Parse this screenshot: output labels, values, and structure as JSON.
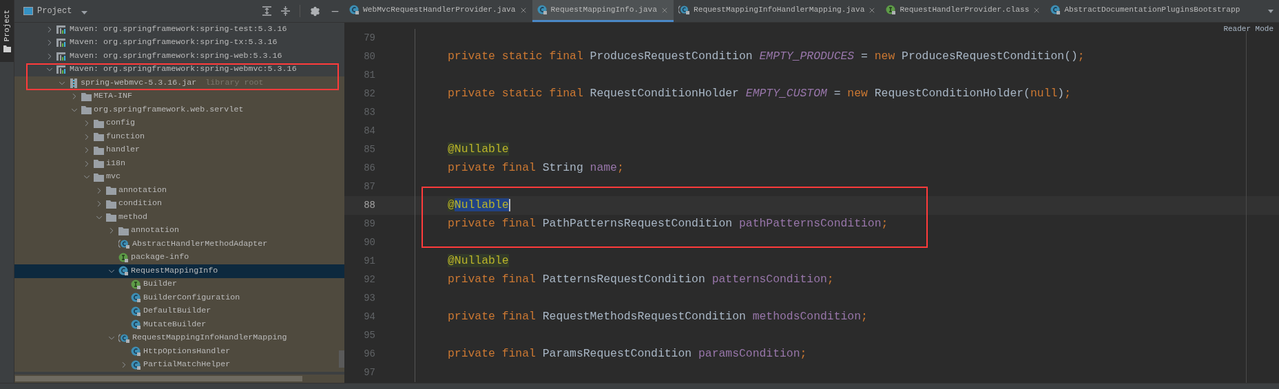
{
  "stripe": {
    "label": "Project"
  },
  "panel": {
    "title": "Project"
  },
  "tree": [
    {
      "kind": "library",
      "label": "Maven: org.springframework:spring-test:5.3.16",
      "expanded": false,
      "selected": false
    },
    {
      "kind": "library",
      "label": "Maven: org.springframework:spring-tx:5.3.16",
      "expanded": false,
      "selected": false
    },
    {
      "kind": "library",
      "label": "Maven: org.springframework:spring-web:5.3.16",
      "expanded": false,
      "selected": false
    },
    {
      "kind": "library",
      "label": "Maven: org.springframework:spring-webmvc:5.3.16",
      "expanded": true,
      "selected": false,
      "boxed": true,
      "children": [
        {
          "kind": "jar",
          "label": "spring-webmvc-5.3.16.jar",
          "note": "library root",
          "expanded": true,
          "selected": false,
          "boxed": true,
          "children": [
            {
              "kind": "folder",
              "label": "META-INF",
              "expanded": false,
              "selected": false
            },
            {
              "kind": "folder",
              "label": "org.springframework.web.servlet",
              "expanded": true,
              "selected": false,
              "children": [
                {
                  "kind": "folder",
                  "label": "config",
                  "expanded": false,
                  "selected": false
                },
                {
                  "kind": "folder",
                  "label": "function",
                  "expanded": false,
                  "selected": false
                },
                {
                  "kind": "folder",
                  "label": "handler",
                  "expanded": false,
                  "selected": false
                },
                {
                  "kind": "folder",
                  "label": "i18n",
                  "expanded": false,
                  "selected": false
                },
                {
                  "kind": "folder",
                  "label": "mvc",
                  "expanded": true,
                  "selected": false,
                  "children": [
                    {
                      "kind": "folder",
                      "label": "annotation",
                      "expanded": false,
                      "selected": false
                    },
                    {
                      "kind": "folder",
                      "label": "condition",
                      "expanded": false,
                      "selected": false
                    },
                    {
                      "kind": "folder",
                      "label": "method",
                      "expanded": true,
                      "selected": false,
                      "children": [
                        {
                          "kind": "folder",
                          "label": "annotation",
                          "expanded": false,
                          "selected": false
                        },
                        {
                          "kind": "abstract",
                          "label": "AbstractHandlerMethodAdapter",
                          "selected": false
                        },
                        {
                          "kind": "interface",
                          "label": "package-info",
                          "selected": false
                        },
                        {
                          "kind": "class",
                          "label": "RequestMappingInfo",
                          "expanded": true,
                          "selected": true,
                          "children": [
                            {
                              "kind": "interface",
                              "label": "Builder",
                              "selected": false
                            },
                            {
                              "kind": "class",
                              "label": "BuilderConfiguration",
                              "selected": false
                            },
                            {
                              "kind": "class",
                              "label": "DefaultBuilder",
                              "selected": false
                            },
                            {
                              "kind": "class",
                              "label": "MutateBuilder",
                              "selected": false
                            }
                          ]
                        },
                        {
                          "kind": "abstract",
                          "label": "RequestMappingInfoHandlerMapping",
                          "expanded": true,
                          "selected": false,
                          "children": [
                            {
                              "kind": "class",
                              "label": "HttpOptionsHandler",
                              "selected": false
                            },
                            {
                              "kind": "class",
                              "label": "PartialMatchHelper",
                              "expanded": false,
                              "selected": false
                            }
                          ]
                        }
                      ]
                    }
                  ]
                }
              ]
            }
          ]
        }
      ]
    }
  ],
  "tabs": [
    {
      "label": "WebMvcRequestHandlerProvider.java",
      "kind": "class",
      "selected": false,
      "closable": true
    },
    {
      "label": "RequestMappingInfo.java",
      "kind": "class",
      "selected": true,
      "closable": true
    },
    {
      "label": "RequestMappingInfoHandlerMapping.java",
      "kind": "abstract",
      "selected": false,
      "closable": true
    },
    {
      "label": "RequestHandlerProvider.class",
      "kind": "interface",
      "selected": false,
      "closable": true
    },
    {
      "label": "AbstractDocumentationPluginsBootstrapp",
      "kind": "class",
      "selected": false,
      "closable": false
    }
  ],
  "reader_mode": "Reader Mode",
  "lines": [
    {
      "number": "79",
      "current": false
    },
    {
      "number": "80",
      "current": false,
      "tokens": [
        {
          "kind": "keyword",
          "text": "private static final "
        },
        {
          "kind": "plain",
          "text": "ProducesRequestCondition "
        },
        {
          "kind": "constant",
          "text": "EMPTY_PRODUCES"
        },
        {
          "kind": "plain",
          "text": " = "
        },
        {
          "kind": "keyword",
          "text": "new "
        },
        {
          "kind": "plain",
          "text": "ProducesRequestCondition()"
        },
        {
          "kind": "keyword",
          "text": ";"
        }
      ]
    },
    {
      "number": "81",
      "current": false
    },
    {
      "number": "82",
      "current": false,
      "tokens": [
        {
          "kind": "keyword",
          "text": "private static final "
        },
        {
          "kind": "plain",
          "text": "RequestConditionHolder "
        },
        {
          "kind": "constant",
          "text": "EMPTY_CUSTOM"
        },
        {
          "kind": "plain",
          "text": " = "
        },
        {
          "kind": "keyword",
          "text": "new "
        },
        {
          "kind": "plain",
          "text": "RequestConditionHolder("
        },
        {
          "kind": "keyword",
          "text": "null"
        },
        {
          "kind": "plain",
          "text": ")"
        },
        {
          "kind": "keyword",
          "text": ";"
        }
      ]
    },
    {
      "number": "83",
      "current": false
    },
    {
      "number": "84",
      "current": false
    },
    {
      "number": "85",
      "current": false,
      "tokens": [
        {
          "kind": "annotation",
          "text": "@Nullable"
        }
      ]
    },
    {
      "number": "86",
      "current": false,
      "tokens": [
        {
          "kind": "keyword",
          "text": "private final "
        },
        {
          "kind": "plain",
          "text": "String "
        },
        {
          "kind": "field",
          "text": "name"
        },
        {
          "kind": "keyword",
          "text": ";"
        }
      ]
    },
    {
      "number": "87",
      "current": false
    },
    {
      "number": "88",
      "current": true,
      "boxed": true,
      "tokens": [
        {
          "kind": "annotation",
          "text": "@"
        },
        {
          "kind": "annotation_selected",
          "text": "Nullable"
        }
      ]
    },
    {
      "number": "89",
      "current": false,
      "boxed": true,
      "tokens": [
        {
          "kind": "keyword",
          "text": "private final "
        },
        {
          "kind": "plain",
          "text": "PathPatternsRequestCondition "
        },
        {
          "kind": "field",
          "text": "pathPatternsCondition"
        },
        {
          "kind": "keyword",
          "text": ";"
        }
      ]
    },
    {
      "number": "90",
      "current": false,
      "boxed": true
    },
    {
      "number": "91",
      "current": false,
      "tokens": [
        {
          "kind": "annotation",
          "text": "@Nullable"
        }
      ]
    },
    {
      "number": "92",
      "current": false,
      "tokens": [
        {
          "kind": "keyword",
          "text": "private final "
        },
        {
          "kind": "plain",
          "text": "PatternsRequestCondition "
        },
        {
          "kind": "field",
          "text": "patternsCondition"
        },
        {
          "kind": "keyword",
          "text": ";"
        }
      ]
    },
    {
      "number": "93",
      "current": false
    },
    {
      "number": "94",
      "current": false,
      "tokens": [
        {
          "kind": "keyword",
          "text": "private final "
        },
        {
          "kind": "plain",
          "text": "RequestMethodsRequestCondition "
        },
        {
          "kind": "field",
          "text": "methodsCondition"
        },
        {
          "kind": "keyword",
          "text": ";"
        }
      ]
    },
    {
      "number": "95",
      "current": false
    },
    {
      "number": "96",
      "current": false,
      "tokens": [
        {
          "kind": "keyword",
          "text": "private final "
        },
        {
          "kind": "plain",
          "text": "ParamsRequestCondition "
        },
        {
          "kind": "field",
          "text": "paramsCondition"
        },
        {
          "kind": "keyword",
          "text": ";"
        }
      ]
    },
    {
      "number": "97",
      "current": false
    }
  ]
}
